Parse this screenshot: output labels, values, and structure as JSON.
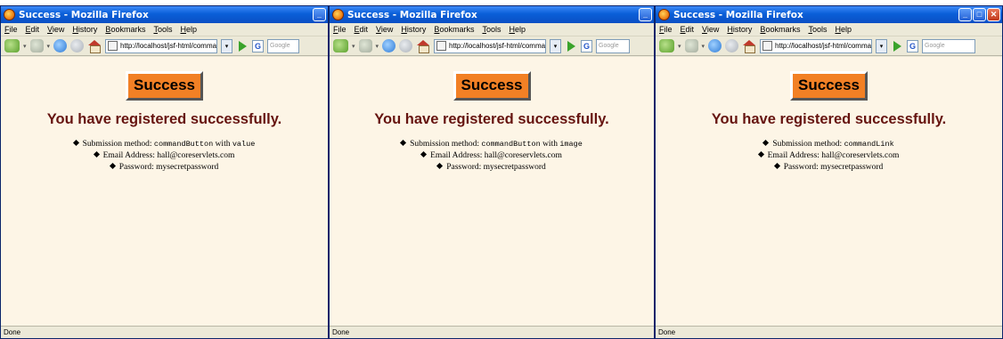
{
  "windows": [
    {
      "title": "Success - Mozilla Firefox",
      "menu": [
        "File",
        "Edit",
        "View",
        "History",
        "Bookmarks",
        "Tools",
        "Help"
      ],
      "url": "http://localhost/jsf-html/comman",
      "search_placeholder": "Google",
      "success_label": "Success",
      "heading": "You have registered successfully.",
      "details": {
        "method_prefix": "Submission method: ",
        "method_code": "commandButton",
        "method_with": " with ",
        "method_variant": "value",
        "email": "Email Address: hall@coreservlets.com",
        "password": "Password: mysecretpassword"
      },
      "status": "Done",
      "window_buttons": [
        "minimize"
      ]
    },
    {
      "title": "Success - Mozilla Firefox",
      "menu": [
        "File",
        "Edit",
        "View",
        "History",
        "Bookmarks",
        "Tools",
        "Help"
      ],
      "url": "http://localhost/jsf-html/comman",
      "search_placeholder": "Google",
      "success_label": "Success",
      "heading": "You have registered successfully.",
      "details": {
        "method_prefix": "Submission method: ",
        "method_code": "commandButton",
        "method_with": " with ",
        "method_variant": "image",
        "email": "Email Address: hall@coreservlets.com",
        "password": "Password: mysecretpassword"
      },
      "status": "Done",
      "window_buttons": [
        "minimize"
      ]
    },
    {
      "title": "Success - Mozilla Firefox",
      "menu": [
        "File",
        "Edit",
        "View",
        "History",
        "Bookmarks",
        "Tools",
        "Help"
      ],
      "url": "http://localhost/jsf-html/comman",
      "search_placeholder": "Google",
      "success_label": "Success",
      "heading": "You have registered successfully.",
      "details": {
        "method_prefix": "Submission method: ",
        "method_code": "commandLink",
        "method_with": "",
        "method_variant": "",
        "email": "Email Address: hall@coreservlets.com",
        "password": "Password: mysecretpassword"
      },
      "status": "Done",
      "window_buttons": [
        "minimize",
        "maximize",
        "close"
      ]
    }
  ],
  "colors": {
    "titlebar": "#0b4fc4",
    "page_background": "#fdf5e6",
    "success_button": "#f28025",
    "heading_text": "#661410"
  }
}
